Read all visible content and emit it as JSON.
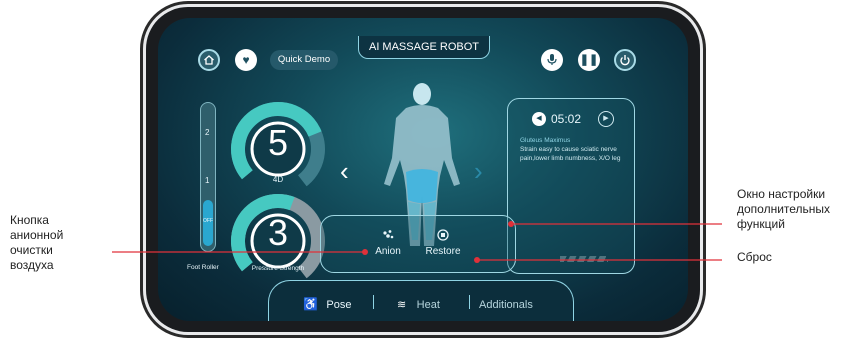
{
  "header": {
    "title": "AI MASSAGE ROBOT",
    "quick_demo": "Quick Demo"
  },
  "levels": {
    "bar_marks": [
      "2",
      "1",
      "OFF"
    ],
    "gauge_top": {
      "value": "5",
      "label": "4D",
      "level": 0.72
    },
    "gauge_bottom": {
      "value": "3",
      "label": "Pressure Strength",
      "level": 0.55
    },
    "foot_roller_label": "Foot Roller"
  },
  "info_panel": {
    "time": "05:02",
    "title": "Gluteus Maximus",
    "description": "Strain easy to cause sciatic nerve pain,lower limb numbness, X/O leg"
  },
  "functions": {
    "anion": "Anion",
    "restore": "Restore"
  },
  "bottom_nav": {
    "pose": "Pose",
    "heat": "Heat",
    "additionals": "Additionals"
  },
  "annotations": {
    "left": [
      "Кнопка",
      "анионной",
      "очистки",
      "воздуха"
    ],
    "right_top": [
      "Окно настройки",
      "дополнительных",
      "функций"
    ],
    "right_bottom": "Сброс"
  },
  "colors": {
    "accent": "#39c3cf",
    "callout_line": "#e0313a",
    "screen_bg": "#124a59"
  }
}
